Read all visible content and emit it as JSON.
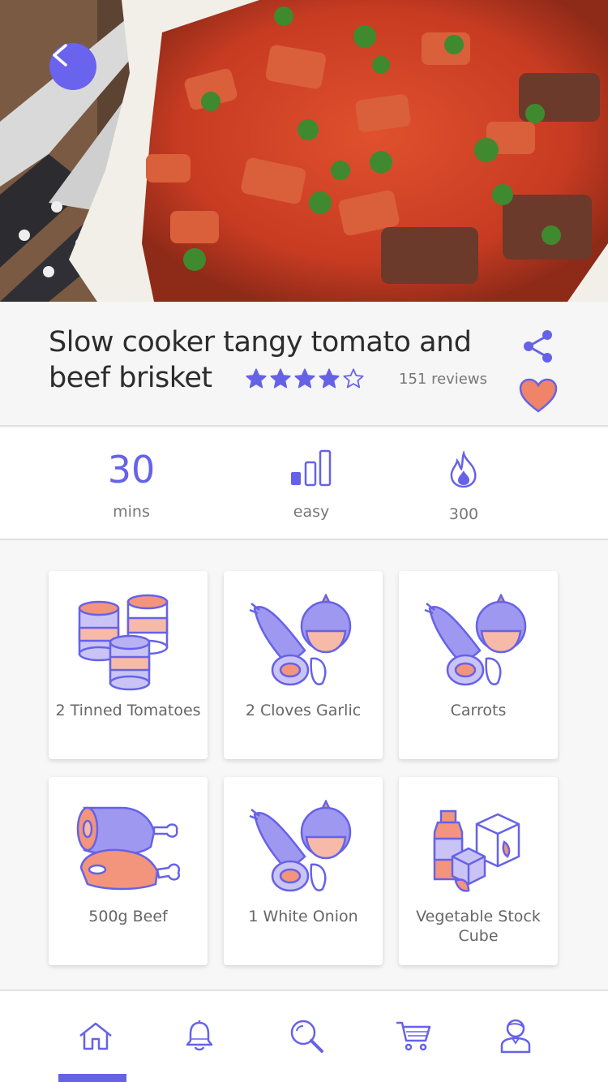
{
  "recipe": {
    "title": "Slow cooker tangy tomato and beef brisket",
    "rating": 4,
    "rating_max": 5,
    "reviews": "151 reviews"
  },
  "stats": {
    "time_value": "30",
    "time_label": "mins",
    "difficulty_label": "easy",
    "calories_label": "300"
  },
  "ingredients": [
    {
      "label": "2 Tinned Tomatoes",
      "icon": "tins-icon"
    },
    {
      "label": "2 Cloves Garlic",
      "icon": "vegetables-icon"
    },
    {
      "label": "Carrots",
      "icon": "vegetables-icon"
    },
    {
      "label": "500g Beef",
      "icon": "meat-icon"
    },
    {
      "label": "1 White Onion",
      "icon": "vegetables-icon"
    },
    {
      "label": "Vegetable Stock Cube",
      "icon": "stock-cube-icon"
    }
  ],
  "nav": [
    {
      "name": "home",
      "icon": "home-icon",
      "active": true
    },
    {
      "name": "notifications",
      "icon": "bell-icon",
      "active": false
    },
    {
      "name": "search",
      "icon": "search-icon",
      "active": false
    },
    {
      "name": "cart",
      "icon": "cart-icon",
      "active": false
    },
    {
      "name": "profile",
      "icon": "user-icon",
      "active": false
    }
  ],
  "colors": {
    "accent": "#6662e8",
    "heart": "#f08468",
    "salmon": "#f3957c"
  }
}
